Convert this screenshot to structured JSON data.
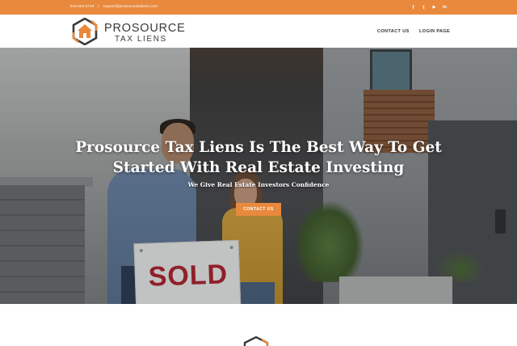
{
  "colors": {
    "accent": "#e8893d",
    "text_dark": "#2f2f2f",
    "white": "#ffffff"
  },
  "topbar": {
    "phone": "844-263-2718",
    "separator": "|",
    "email": "support@prosourcetaxliens.com",
    "social": [
      {
        "icon": "facebook-icon",
        "glyph": "f"
      },
      {
        "icon": "twitter-icon",
        "glyph": "t"
      },
      {
        "icon": "youtube-icon",
        "glyph": "▶"
      },
      {
        "icon": "linkedin-icon",
        "glyph": "in"
      }
    ]
  },
  "header": {
    "logo": {
      "title": "PROSOURCE",
      "subtitle": "TAX LIENS"
    },
    "nav": [
      {
        "label": "CONTACT US"
      },
      {
        "label": "LOGIN PAGE"
      }
    ]
  },
  "hero": {
    "title": "Prosource Tax Liens Is The Best Way To Get Started With Real Estate Investing",
    "subtitle": "We Give Real Estate Investors Confidence",
    "cta_label": "CONTACT US",
    "sign_text": "SOLD"
  }
}
